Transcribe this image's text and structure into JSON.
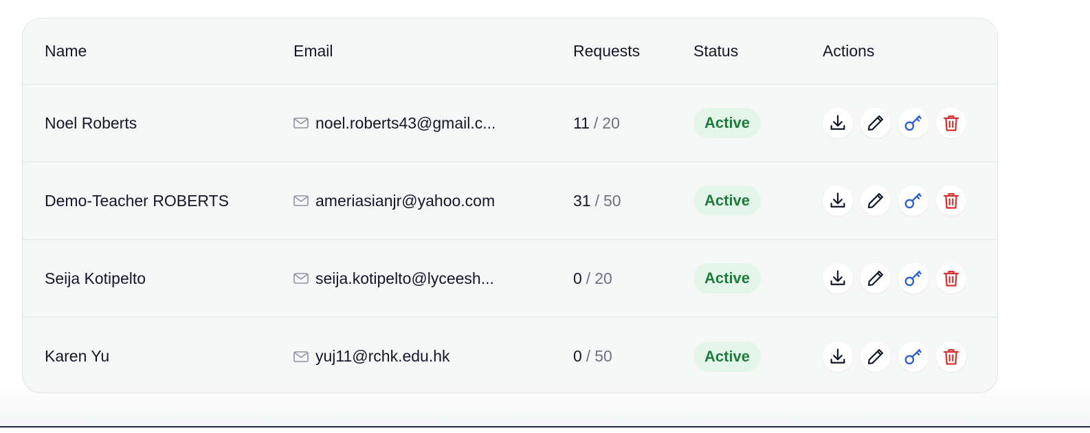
{
  "table": {
    "headers": {
      "name": "Name",
      "email": "Email",
      "requests": "Requests",
      "status": "Status",
      "actions": "Actions"
    },
    "rows": [
      {
        "name": "Noel Roberts",
        "email": "noel.roberts43@gmail.c...",
        "requests_used": "11",
        "requests_separator": "/",
        "requests_limit": "20",
        "status": "Active"
      },
      {
        "name": "Demo-Teacher ROBERTS",
        "email": "ameriasianjr@yahoo.com",
        "requests_used": "31",
        "requests_separator": "/",
        "requests_limit": "50",
        "status": "Active"
      },
      {
        "name": "Seija Kotipelto",
        "email": "seija.kotipelto@lyceesh...",
        "requests_used": "0",
        "requests_separator": "/",
        "requests_limit": "20",
        "status": "Active"
      },
      {
        "name": "Karen Yu",
        "email": "yuj11@rchk.edu.hk",
        "requests_used": "0",
        "requests_separator": "/",
        "requests_limit": "50",
        "status": "Active"
      }
    ],
    "row_actions": [
      "download-icon",
      "edit-pencil-icon",
      "key-icon",
      "trash-icon"
    ]
  },
  "colors": {
    "status_active_bg": "#e4f6e9",
    "status_active_text": "#1f7a3d",
    "key_icon": "#2f5fd0",
    "trash_icon": "#d32f2f",
    "table_bg": "#f6f7f7"
  }
}
